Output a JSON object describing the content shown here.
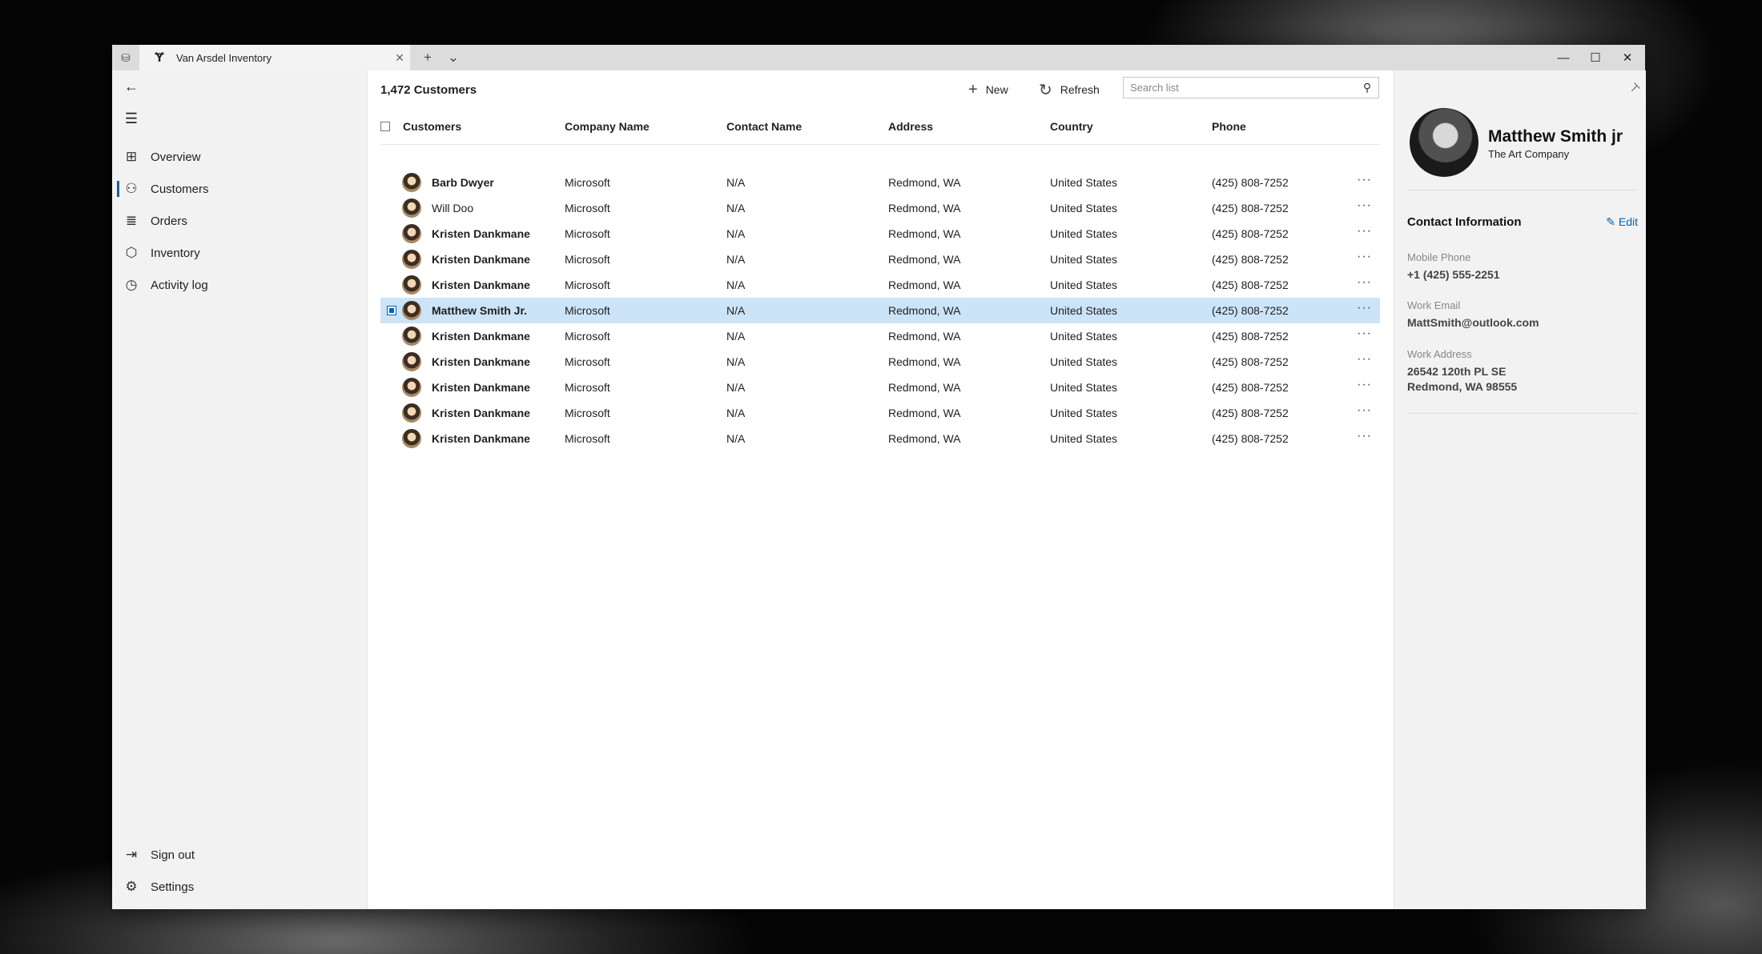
{
  "window": {
    "tab_title": "Van Arsdel Inventory",
    "tab_close": "✕",
    "new_tab": "+",
    "tab_menu": "⌄",
    "minimize": "—",
    "maximize": "☐",
    "close": "✕"
  },
  "nav": {
    "items": [
      {
        "label": "Overview",
        "icon": "overview-icon"
      },
      {
        "label": "Customers",
        "icon": "person-icon",
        "selected": true
      },
      {
        "label": "Orders",
        "icon": "list-icon"
      },
      {
        "label": "Inventory",
        "icon": "box-icon"
      },
      {
        "label": "Activity log",
        "icon": "clock-icon"
      }
    ],
    "sign_out": "Sign out",
    "settings": "Settings"
  },
  "main": {
    "count_label": "1,472 Customers",
    "new_label": "New",
    "refresh_label": "Refresh",
    "search_placeholder": "Search list",
    "columns": [
      "Customers",
      "Company Name",
      "Contact Name",
      "Address",
      "Country",
      "Phone"
    ],
    "rows": [
      {
        "name": "Barb Dwyer",
        "company": "Microsoft",
        "contact": "N/A",
        "address": "Redmond, WA",
        "country": "United States",
        "phone": "(425) 808-7252",
        "bold": true
      },
      {
        "name": "Will Doo",
        "company": "Microsoft",
        "contact": "N/A",
        "address": "Redmond, WA",
        "country": "United States",
        "phone": "(425) 808-7252",
        "bold": false
      },
      {
        "name": "Kristen Dankmane",
        "company": "Microsoft",
        "contact": "N/A",
        "address": "Redmond, WA",
        "country": "United States",
        "phone": "(425) 808-7252",
        "bold": true
      },
      {
        "name": "Kristen Dankmane",
        "company": "Microsoft",
        "contact": "N/A",
        "address": "Redmond, WA",
        "country": "United States",
        "phone": "(425) 808-7252",
        "bold": true
      },
      {
        "name": "Kristen Dankmane",
        "company": "Microsoft",
        "contact": "N/A",
        "address": "Redmond, WA",
        "country": "United States",
        "phone": "(425) 808-7252",
        "bold": true
      },
      {
        "name": "Matthew Smith Jr.",
        "company": "Microsoft",
        "contact": "N/A",
        "address": "Redmond, WA",
        "country": "United States",
        "phone": "(425) 808-7252",
        "bold": true,
        "selected": true
      },
      {
        "name": "Kristen Dankmane",
        "company": "Microsoft",
        "contact": "N/A",
        "address": "Redmond, WA",
        "country": "United States",
        "phone": "(425) 808-7252",
        "bold": true
      },
      {
        "name": "Kristen Dankmane",
        "company": "Microsoft",
        "contact": "N/A",
        "address": "Redmond, WA",
        "country": "United States",
        "phone": "(425) 808-7252",
        "bold": true
      },
      {
        "name": "Kristen Dankmane",
        "company": "Microsoft",
        "contact": "N/A",
        "address": "Redmond, WA",
        "country": "United States",
        "phone": "(425) 808-7252",
        "bold": true
      },
      {
        "name": "Kristen Dankmane",
        "company": "Microsoft",
        "contact": "N/A",
        "address": "Redmond, WA",
        "country": "United States",
        "phone": "(425) 808-7252",
        "bold": true
      },
      {
        "name": "Kristen Dankmane",
        "company": "Microsoft",
        "contact": "N/A",
        "address": "Redmond, WA",
        "country": "United States",
        "phone": "(425) 808-7252",
        "bold": true
      }
    ]
  },
  "detail": {
    "name": "Matthew Smith jr",
    "company": "The Art Company",
    "section_title": "Contact Information",
    "edit_label": "Edit",
    "fields": [
      {
        "label": "Mobile Phone",
        "value": "+1 (425) 555-2251"
      },
      {
        "label": "Work Email",
        "value": "MattSmith@outlook.com"
      },
      {
        "label": "Work Address",
        "value": "26542 120th PL SE",
        "value2": "Redmond, WA 98555"
      }
    ]
  },
  "colors": {
    "accent": "#0063b1",
    "selection": "#cce4f7",
    "pane_background": "#f2f2f2"
  }
}
